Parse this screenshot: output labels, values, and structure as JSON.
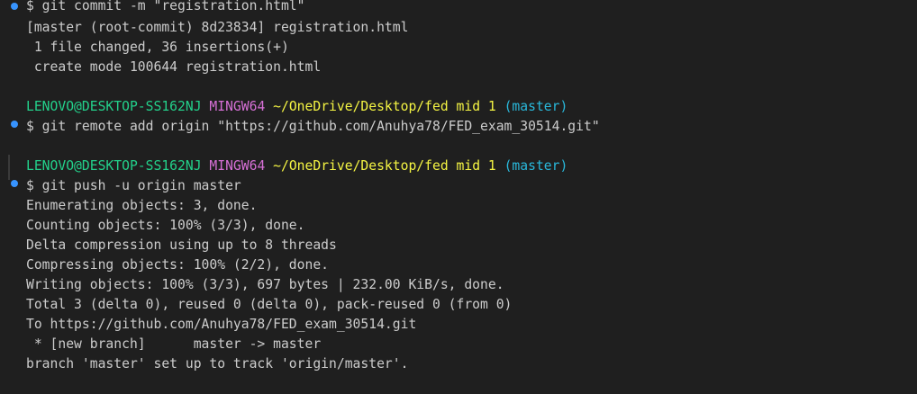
{
  "terminal": {
    "block1": {
      "command": "$ git commit -m \"registration.html\"",
      "output": [
        "[master (root-commit) 8d23834] registration.html",
        " 1 file changed, 36 insertions(+)",
        " create mode 100644 registration.html"
      ]
    },
    "prompt": {
      "user": "LENOVO@DESKTOP-SS162NJ",
      "env": "MINGW64",
      "path": "~/OneDrive/Desktop/fed mid 1",
      "branch": "(master)"
    },
    "block2": {
      "command": "$ git remote add origin \"https://github.com/Anuhya78/FED_exam_30514.git\""
    },
    "block3": {
      "command": "$ git push -u origin master",
      "output": [
        "Enumerating objects: 3, done.",
        "Counting objects: 100% (3/3), done.",
        "Delta compression using up to 8 threads",
        "Compressing objects: 100% (2/2), done.",
        "Writing objects: 100% (3/3), 697 bytes | 232.00 KiB/s, done.",
        "Total 3 (delta 0), reused 0 (delta 0), pack-reused 0 (from 0)",
        "To https://github.com/Anuhya78/FED_exam_30514.git",
        " * [new branch]      master -> master",
        "branch 'master' set up to track 'origin/master'."
      ]
    },
    "colors": {
      "background": "#1f1f1f",
      "text": "#cccccc",
      "user": "#23d18b",
      "env": "#d670d6",
      "path": "#f5f543",
      "branch": "#29b8db",
      "command_decoration": "#3794ff"
    }
  }
}
